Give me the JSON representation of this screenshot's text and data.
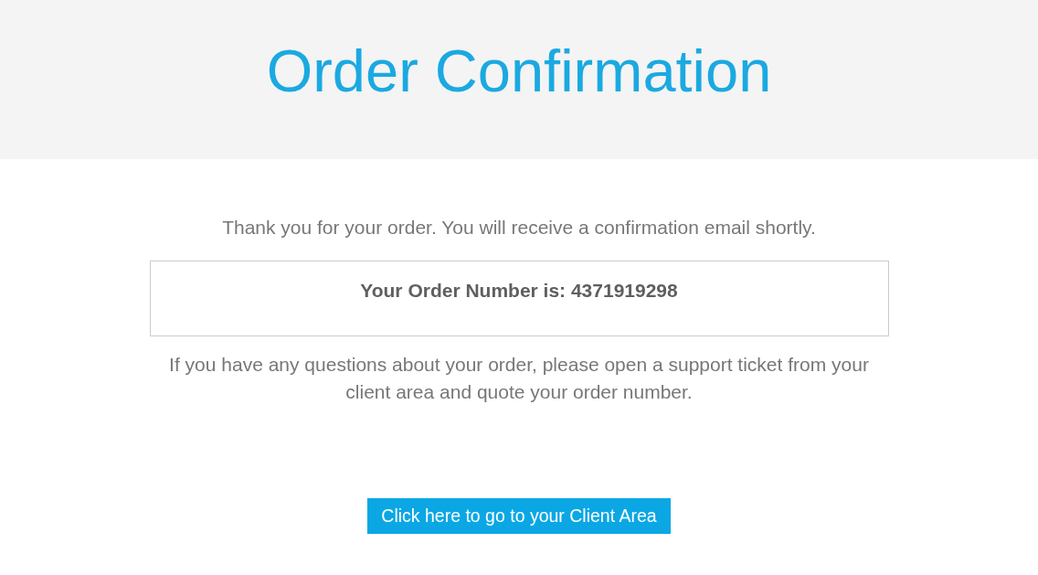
{
  "header": {
    "title": "Order Confirmation"
  },
  "message": "Thank you for your order. You will receive a confirmation email shortly.",
  "order_box": {
    "text": "Your Order Number is: 4371919298"
  },
  "note": "If you have any questions about your order, please open a support ticket from your client area and quote your order number.",
  "button": {
    "label": "Click here to go to your Client Area"
  }
}
